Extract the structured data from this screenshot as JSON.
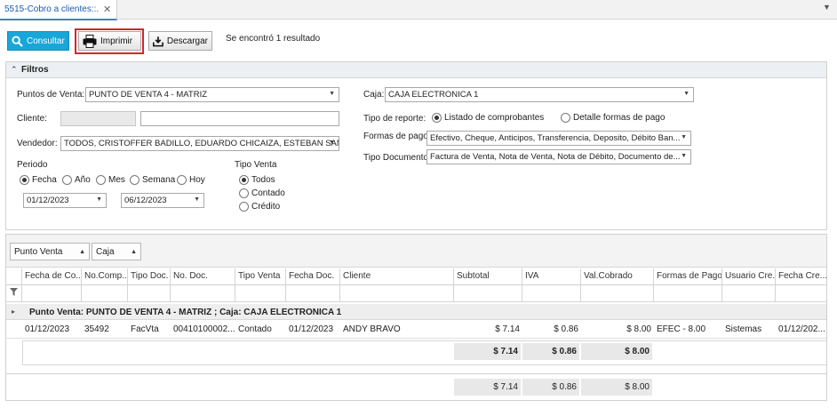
{
  "tab": {
    "title": "5515-Cobro a clientes::.",
    "close": "✕",
    "menu": "▼"
  },
  "toolbar": {
    "consultar": "Consultar",
    "imprimir": "Imprimir",
    "descargar": "Descargar",
    "result_text": "Se encontró 1 resultado"
  },
  "filters": {
    "title": "Filtros",
    "puntos_venta_label": "Puntos de Venta:",
    "puntos_venta_value": "PUNTO DE VENTA 4 - MATRIZ",
    "cliente_label": "Cliente:",
    "vendedor_label": "Vendedor:",
    "vendedor_value": "TODOS, CRISTOFFER BADILLO, EDUARDO CHICAIZA, ESTEBAN SAN ...",
    "periodo_label": "Periodo",
    "periodo_options": [
      "Fecha",
      "Año",
      "Mes",
      "Semana",
      "Hoy"
    ],
    "periodo_selected": "Fecha",
    "fecha_desde": "01/12/2023",
    "fecha_hasta": "06/12/2023",
    "tipo_venta_label": "Tipo Venta",
    "tipo_venta_options": [
      "Todos",
      "Contado",
      "Crédito"
    ],
    "tipo_venta_selected": "Todos",
    "caja_label": "Caja:",
    "caja_value": "CAJA ELECTRONICA 1",
    "tipo_reporte_label": "Tipo de reporte:",
    "tipo_reporte_options": [
      "Listado de comprobantes",
      "Detalle formas de pago"
    ],
    "tipo_reporte_selected": "Listado de comprobantes",
    "formas_pago_label": "Formas de pago",
    "formas_pago_value": "Efectivo, Cheque, Anticipos, Transferencia, Deposito, Débito Ban...",
    "tipo_documento_label": "Tipo Documento",
    "tipo_documento_value": "Factura de Venta, Nota de Venta, Nota de Débito, Documento de..."
  },
  "grid": {
    "group_chips": [
      "Punto Venta",
      "Caja"
    ],
    "columns": [
      "Fecha de Co...",
      "No.Comp...",
      "Tipo Doc.",
      "No. Doc.",
      "Tipo Venta",
      "Fecha Doc.",
      "Cliente",
      "Subtotal",
      "IVA",
      "Val.Cobrado",
      "Formas de Pago",
      "Usuario Cre...",
      "Fecha Cre..."
    ],
    "group_label": "Punto Venta: PUNTO DE VENTA 4 - MATRIZ ; Caja: CAJA ELECTRONICA 1",
    "rows": [
      [
        "01/12/2023",
        "35492",
        "FacVta",
        "00410100002...",
        "Contado",
        "01/12/2023",
        "ANDY BRAVO",
        "$ 7.14",
        "$ 0.86",
        "$ 8.00",
        "EFEC - 8.00",
        "Sistemas",
        "01/12/202..."
      ]
    ],
    "group_totals": {
      "subtotal": "$ 7.14",
      "iva": "$ 0.86",
      "cobrado": "$ 8.00"
    },
    "grand_totals": {
      "subtotal": "$ 7.14",
      "iva": "$ 0.86",
      "cobrado": "$ 8.00"
    }
  }
}
